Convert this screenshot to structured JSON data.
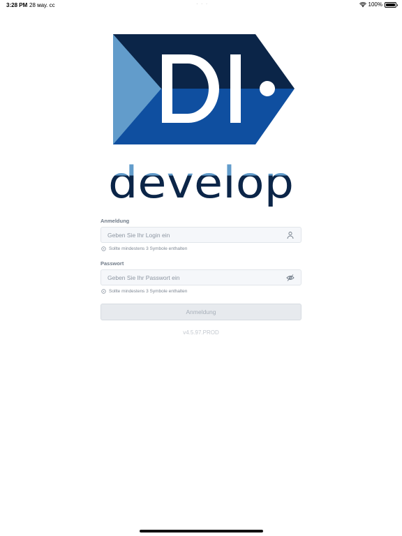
{
  "status_bar": {
    "time": "3:28 PM",
    "date": "28 мау. сс",
    "dots": "· · ·",
    "battery": "100%"
  },
  "brand": {
    "wordmark": "develop",
    "logo_letters": "DI",
    "colors": {
      "navy": "#0b2548",
      "blue": "#0f4fa0",
      "light_blue": "#629ccb"
    }
  },
  "form": {
    "login": {
      "label": "Anmeldung",
      "placeholder": "Geben Sie Ihr Login ein",
      "icon": "user-icon",
      "hint": "Sollte mindestens 3 Symbole enthalten"
    },
    "password": {
      "label": "Passwort",
      "placeholder": "Geben Sie Ihr Passwort ein",
      "icon": "eye-off-icon",
      "hint": "Sollte mindestens 3 Symbole enthalten"
    },
    "submit_label": "Anmeldung",
    "version": "v4.5.97.PROD"
  }
}
